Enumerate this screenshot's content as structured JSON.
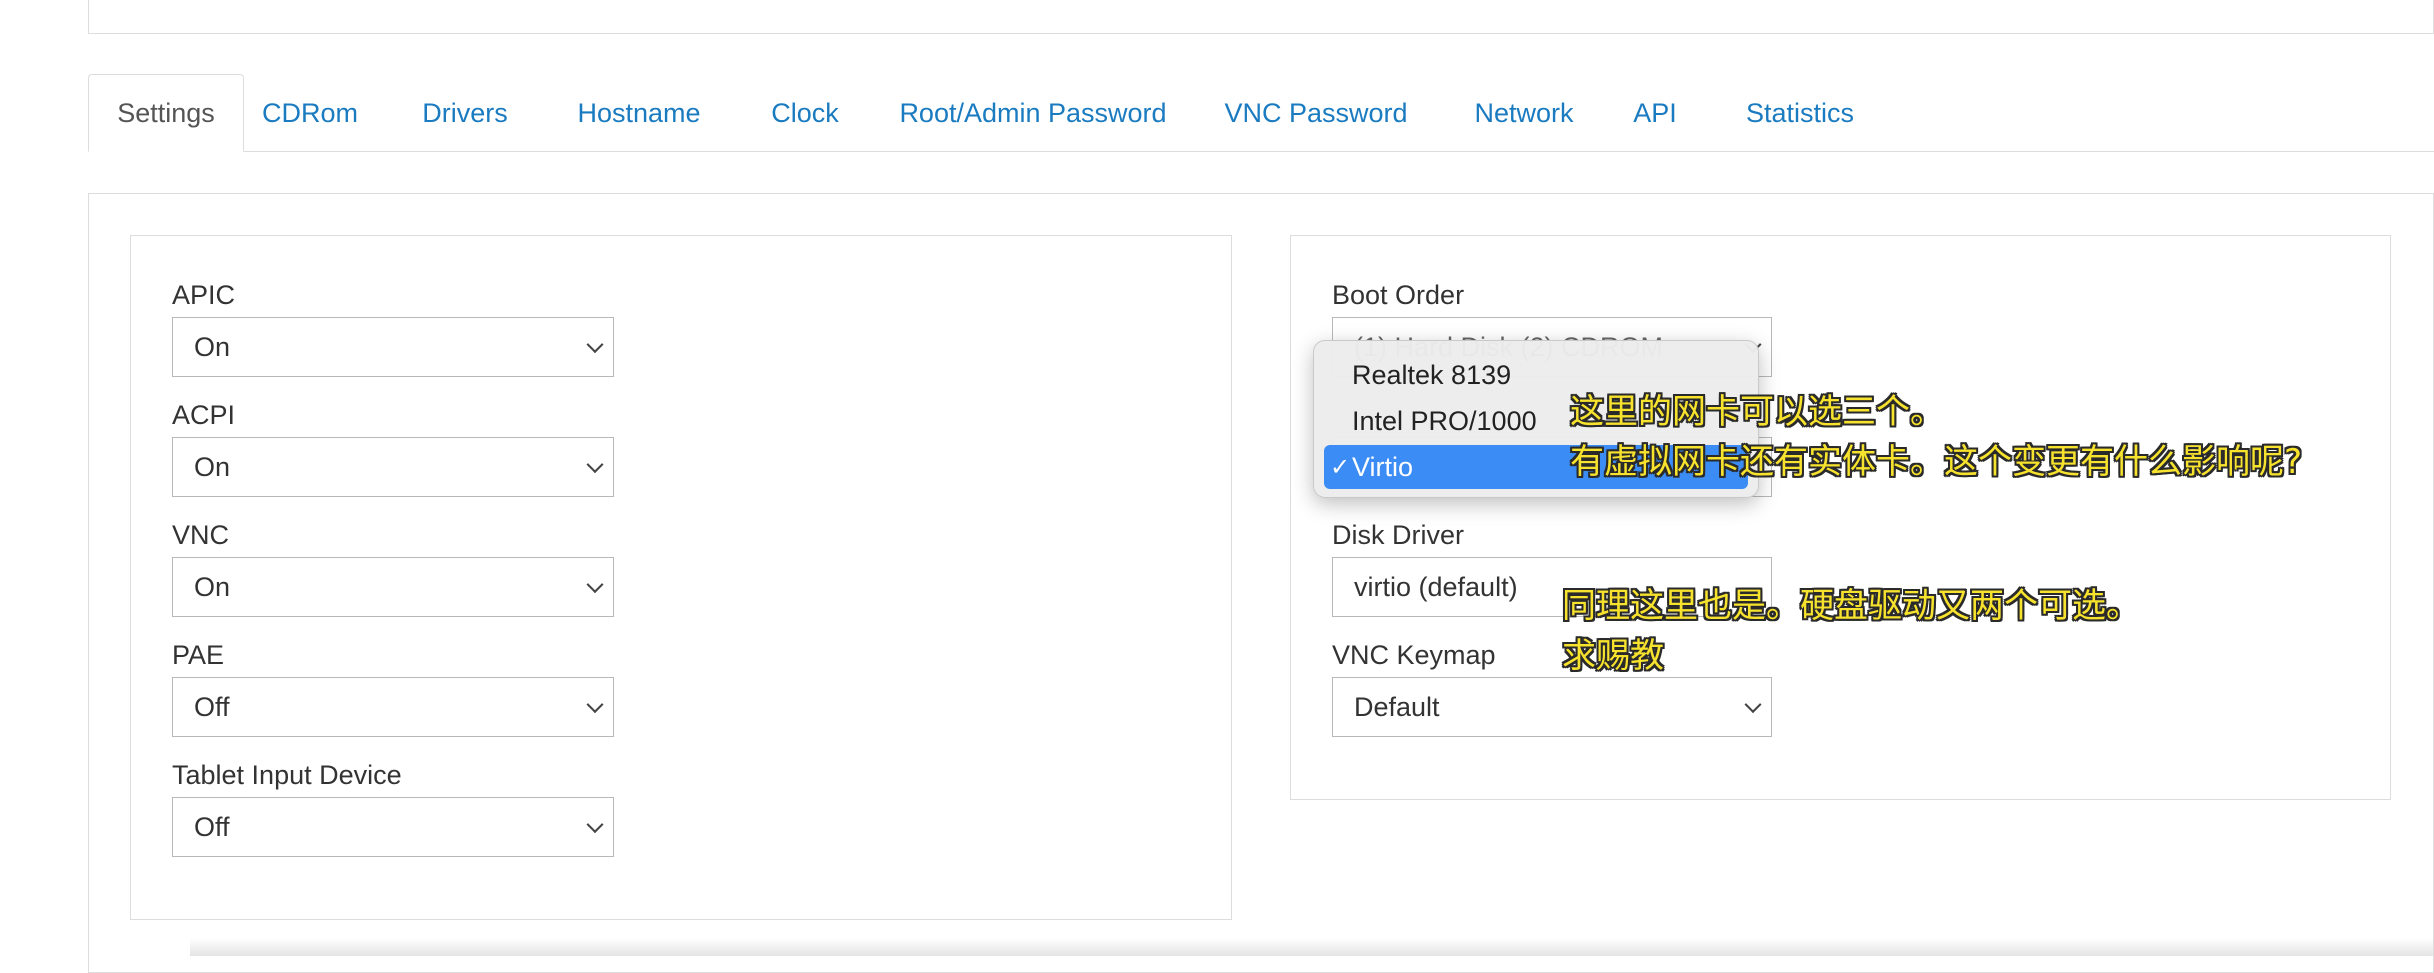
{
  "tabs": [
    {
      "label": "Settings",
      "active": true
    },
    {
      "label": "CDRom"
    },
    {
      "label": "Drivers"
    },
    {
      "label": "Hostname"
    },
    {
      "label": "Clock"
    },
    {
      "label": "Root/Admin Password"
    },
    {
      "label": "VNC Password"
    },
    {
      "label": "Network"
    },
    {
      "label": "API"
    },
    {
      "label": "Statistics"
    }
  ],
  "left": {
    "apic": {
      "label": "APIC",
      "value": "On"
    },
    "acpi": {
      "label": "ACPI",
      "value": "On"
    },
    "vnc": {
      "label": "VNC",
      "value": "On"
    },
    "pae": {
      "label": "PAE",
      "value": "Off"
    },
    "tablet": {
      "label": "Tablet Input Device",
      "value": "Off"
    }
  },
  "right": {
    "boot_order": {
      "label": "Boot Order",
      "value": "(1) Hard Disk (2) CDROM"
    },
    "disk_driver": {
      "label": "Disk Driver",
      "value": "virtio (default)"
    },
    "vnc_keymap": {
      "label": "VNC Keymap",
      "value": "Default"
    }
  },
  "nic_dropdown": {
    "options": [
      "Realtek 8139",
      "Intel PRO/1000",
      "Virtio"
    ],
    "selected": "Virtio",
    "check_glyph": "✓"
  },
  "annotations": {
    "nic_line1": "这里的网卡可以选三个。",
    "nic_line2": "有虚拟网卡还有实体卡。这个变更有什么影响呢?",
    "disk_line1": "同理这里也是。硬盘驱动又两个可选。",
    "disk_line2": "求赐教"
  },
  "colors": {
    "tab_link": "#1a7bc0",
    "selected_option": "#3b8cf5",
    "annotation_text": "#f7e22d"
  }
}
